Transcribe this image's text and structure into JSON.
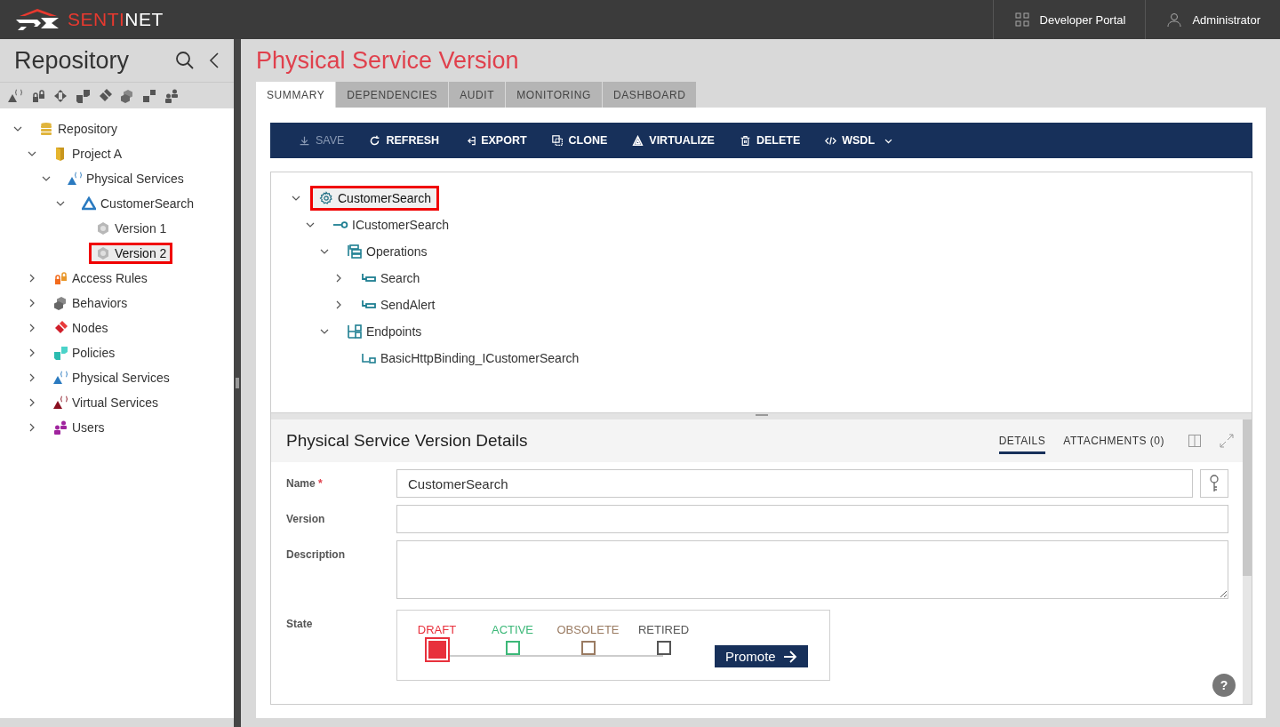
{
  "header": {
    "brand": [
      {
        "text": "SENTI",
        "color": "#e8392f"
      },
      {
        "text": "NET",
        "color": "#ffffff"
      }
    ],
    "nav": [
      {
        "label": "Developer Portal",
        "kind": "grid"
      },
      {
        "label": "Administrator",
        "kind": "user"
      }
    ]
  },
  "sidebar": {
    "title": "Repository",
    "filters": [
      {
        "kind": "physical"
      },
      {
        "kind": "lock"
      },
      {
        "kind": "arrows"
      },
      {
        "kind": "policy"
      },
      {
        "kind": "node"
      },
      {
        "kind": "behavior"
      },
      {
        "kind": "squares"
      },
      {
        "kind": "users"
      }
    ],
    "tree": [
      {
        "label": "Repository",
        "kind": "database",
        "expanded": true,
        "selected": false,
        "children": [
          {
            "label": "Project A",
            "kind": "project",
            "expanded": true,
            "selected": false,
            "children": [
              {
                "label": "Physical Services",
                "kind": "physical",
                "expanded": true,
                "selected": false,
                "children": [
                  {
                    "label": "CustomerSearch",
                    "kind": "service",
                    "expanded": true,
                    "selected": false,
                    "children": [
                      {
                        "label": "Version 1",
                        "kind": "version",
                        "selected": false
                      },
                      {
                        "label": "Version 2",
                        "kind": "version",
                        "selected": true
                      }
                    ]
                  }
                ]
              }
            ]
          },
          {
            "label": "Access Rules",
            "kind": "lock",
            "expanded": false,
            "selected": false
          },
          {
            "label": "Behaviors",
            "kind": "behavior",
            "expanded": false,
            "selected": false
          },
          {
            "label": "Nodes",
            "kind": "node",
            "expanded": false,
            "selected": false
          },
          {
            "label": "Policies",
            "kind": "policy",
            "expanded": false,
            "selected": false
          },
          {
            "label": "Physical Services",
            "kind": "physical",
            "expanded": false,
            "selected": false
          },
          {
            "label": "Virtual Services",
            "kind": "virtual",
            "expanded": false,
            "selected": false
          },
          {
            "label": "Users",
            "kind": "users",
            "expanded": false,
            "selected": false
          }
        ]
      }
    ]
  },
  "main": {
    "title": "Physical Service Version",
    "tabs": [
      {
        "label": "SUMMARY",
        "selected": true
      },
      {
        "label": "DEPENDENCIES",
        "selected": false
      },
      {
        "label": "AUDIT",
        "selected": false
      },
      {
        "label": "MONITORING",
        "selected": false
      },
      {
        "label": "DASHBOARD",
        "selected": false
      }
    ],
    "toolbar": [
      {
        "label": "SAVE",
        "kind": "save",
        "disabled": true
      },
      {
        "label": "REFRESH",
        "kind": "refresh",
        "disabled": false
      },
      {
        "label": "EXPORT",
        "kind": "export",
        "disabled": false
      },
      {
        "label": "CLONE",
        "kind": "clone",
        "disabled": false
      },
      {
        "label": "VIRTUALIZE",
        "kind": "virtualize",
        "disabled": false
      },
      {
        "label": "DELETE",
        "kind": "delete",
        "disabled": false
      },
      {
        "label": "WSDL",
        "kind": "wsdl",
        "disabled": false
      }
    ],
    "service_tree": [
      {
        "label": "CustomerSearch",
        "kind": "gear",
        "expanded": true,
        "selected": true,
        "children": [
          {
            "label": "ICustomerSearch",
            "kind": "interface",
            "expanded": true,
            "selected": false,
            "children": [
              {
                "label": "Operations",
                "kind": "operations",
                "expanded": true,
                "selected": false,
                "children": [
                  {
                    "label": "Search",
                    "kind": "operation",
                    "expanded": false,
                    "selected": false
                  },
                  {
                    "label": "SendAlert",
                    "kind": "operation",
                    "expanded": false,
                    "selected": false
                  }
                ]
              },
              {
                "label": "Endpoints",
                "kind": "endpoints",
                "expanded": true,
                "selected": false,
                "children": [
                  {
                    "label": "BasicHttpBinding_ICustomerSearch",
                    "kind": "endpoint",
                    "selected": false
                  }
                ]
              }
            ]
          }
        ]
      }
    ],
    "details": {
      "title": "Physical Service Version Details",
      "tabs": [
        {
          "label": "DETAILS",
          "selected": true
        },
        {
          "label": "ATTACHMENTS (0)",
          "selected": false
        }
      ],
      "fields": [
        {
          "label": "Name",
          "required_mark": "*",
          "kind": "input",
          "value": "CustomerSearch"
        },
        {
          "label": "Version",
          "kind": "input"
        },
        {
          "label": "Description",
          "kind": "textarea"
        }
      ],
      "state": {
        "label": "State",
        "steps": [
          {
            "label": "DRAFT",
            "color": "#e8303c",
            "selected": true
          },
          {
            "label": "ACTIVE",
            "color": "#3cb878",
            "selected": false
          },
          {
            "label": "OBSOLETE",
            "color": "#9a7b62",
            "selected": false
          },
          {
            "label": "RETIRED",
            "color": "#555555",
            "selected": false
          }
        ],
        "button": "Promote"
      },
      "help": "?"
    }
  }
}
